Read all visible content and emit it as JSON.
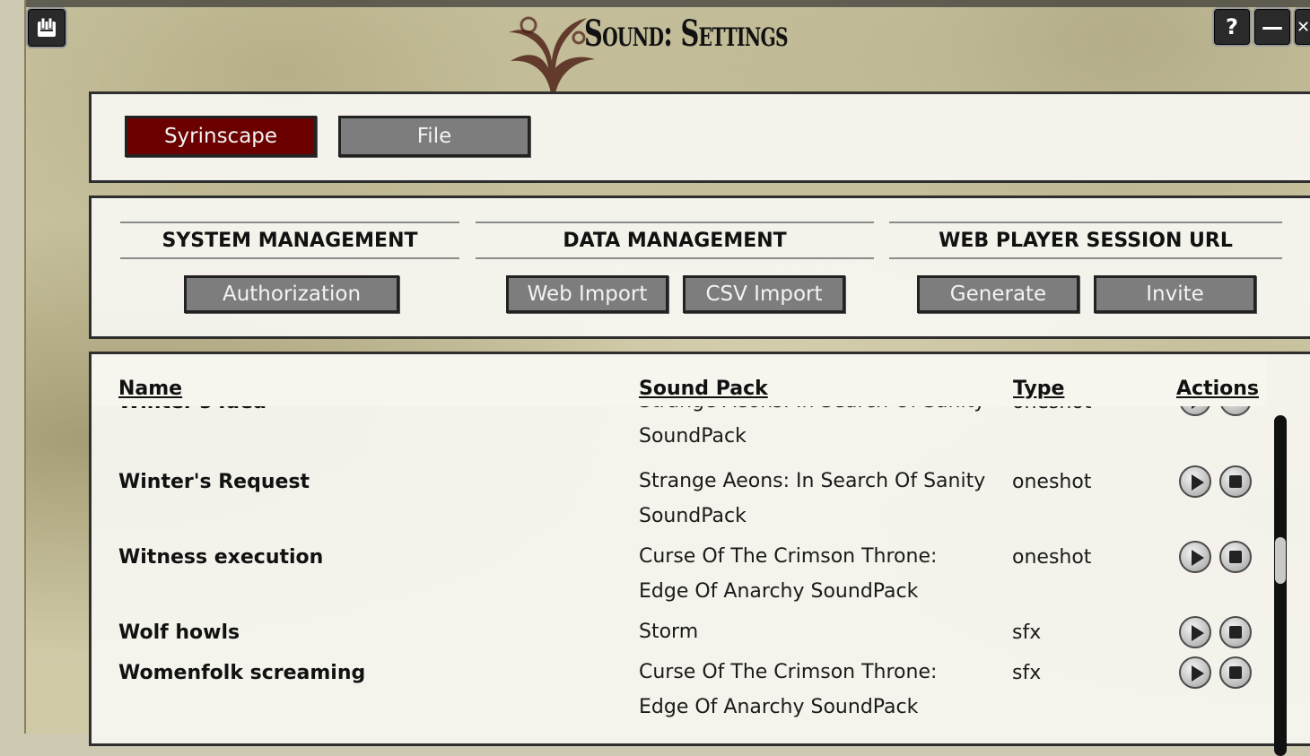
{
  "window": {
    "title": "Sound: Settings",
    "help_label": "?",
    "minimize_label": "—",
    "close_label": "✕"
  },
  "tabs": [
    {
      "label": "Syrinscape",
      "active": true
    },
    {
      "label": "File",
      "active": false
    }
  ],
  "sections": {
    "system": {
      "title": "SYSTEM MANAGEMENT",
      "buttons": [
        "Authorization"
      ]
    },
    "data": {
      "title": "DATA MANAGEMENT",
      "buttons": [
        "Web Import",
        "CSV Import"
      ]
    },
    "web_player": {
      "title": "WEB PLAYER SESSION URL",
      "buttons": [
        "Generate",
        "Invite"
      ]
    }
  },
  "table": {
    "headers": {
      "name": "Name",
      "sound_pack": "Sound Pack",
      "type": "Type",
      "actions": "Actions"
    },
    "rows": [
      {
        "name": "Winter's Idea",
        "pack_line1": "Strange Aeons: In Search Of Sanity",
        "pack_line2": "SoundPack",
        "type": "oneshot"
      },
      {
        "name": "Winter's Request",
        "pack_line1": "Strange Aeons: In Search Of Sanity",
        "pack_line2": "SoundPack",
        "type": "oneshot"
      },
      {
        "name": "Witness execution",
        "pack_line1": "Curse Of The Crimson Throne:",
        "pack_line2": "Edge Of Anarchy SoundPack",
        "type": "oneshot"
      },
      {
        "name": "Wolf howls",
        "pack_line1": "Storm",
        "pack_line2": "",
        "type": "sfx"
      },
      {
        "name": "Womenfolk screaming",
        "pack_line1": "Curse Of The Crimson Throne:",
        "pack_line2": "Edge Of Anarchy SoundPack",
        "type": "sfx"
      }
    ]
  },
  "colors": {
    "active_tab": "#6b0000",
    "button": "#7d7d7d",
    "panel": "#f6f5ee"
  }
}
